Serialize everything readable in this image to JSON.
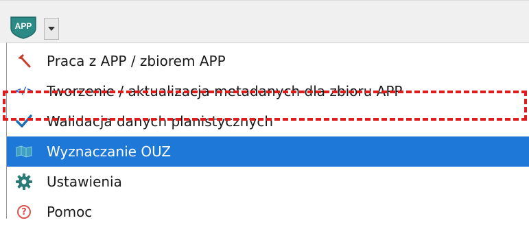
{
  "toolbar": {
    "app_button_text": "APP",
    "dropdown_icon": "triangle-down-icon"
  },
  "menu": {
    "items": [
      {
        "label": "Praca z APP / zbiorem APP",
        "icon": "hammer-icon"
      },
      {
        "label": "Tworzenie / aktualizacja metadanych dla zbioru APP",
        "icon": "code-tag-icon",
        "icon_text": "</>"
      },
      {
        "label": "Walidacja danych planistycznych",
        "icon": "checkmark-icon"
      },
      {
        "label": "Wyznaczanie OUZ",
        "icon": "map-icon",
        "selected": true
      },
      {
        "label": "Ustawienia",
        "icon": "gear-icon"
      },
      {
        "label": "Pomoc",
        "icon": "help-icon",
        "icon_text": "?"
      }
    ]
  },
  "colors": {
    "selection": "#1e78d8",
    "highlight_border": "#e01b1b",
    "shield": "#2c8a86",
    "code_tag": "#2a64c8",
    "checkmark": "#1c6fb5",
    "gear": "#2a7a78",
    "help": "#d9534f",
    "hammer": "#c83a2a"
  }
}
